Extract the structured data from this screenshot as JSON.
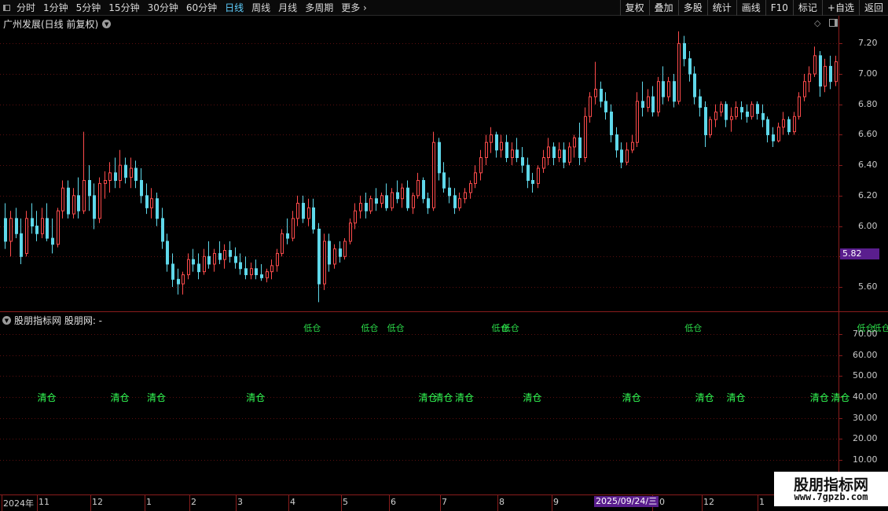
{
  "toolbar": {
    "periods": [
      {
        "label": "分时",
        "active": false
      },
      {
        "label": "1分钟",
        "active": false
      },
      {
        "label": "5分钟",
        "active": false
      },
      {
        "label": "15分钟",
        "active": false
      },
      {
        "label": "30分钟",
        "active": false
      },
      {
        "label": "60分钟",
        "active": false
      },
      {
        "label": "日线",
        "active": true
      },
      {
        "label": "周线",
        "active": false
      },
      {
        "label": "月线",
        "active": false
      },
      {
        "label": "多周期",
        "active": false
      }
    ],
    "more_label": "更多",
    "buttons": [
      "复权",
      "叠加",
      "多股",
      "统计",
      "画线",
      "F10",
      "标记",
      "+自选",
      "返回"
    ]
  },
  "main_panel": {
    "title": "广州发展(日线 前复权)",
    "price_ticks": [
      7.2,
      7.0,
      6.8,
      6.6,
      6.4,
      6.2,
      6.0,
      5.8,
      5.6
    ],
    "current_price_label": "5.82",
    "colors": {
      "up": "#ff4b4b",
      "down": "#5fd8ea",
      "current_price_bg": "#5a1e8e",
      "grid": "#5a0f0f"
    }
  },
  "indicator_panel": {
    "title": "股朋指标网  股朋网: -",
    "value_ticks": [
      "70.00",
      "60.00",
      "50.00",
      "40.00",
      "30.00",
      "20.00",
      "10.00"
    ],
    "signal_label": "清仓",
    "top_signal_label": "低仓",
    "signal_color": "#33ff55"
  },
  "date_axis": {
    "labels": [
      "2024年",
      "11",
      "12",
      "1",
      "2",
      "3",
      "4",
      "5",
      "6",
      "7",
      "8",
      "9",
      "10",
      "12",
      "1"
    ],
    "cursor_date": "2025/09/24/三"
  },
  "watermark": {
    "title": "股朋指标网",
    "url": "www.7gpzb.com"
  },
  "chart_data": {
    "type": "candlestick",
    "title": "广州发展(日线 前复权)",
    "ylim": [
      5.45,
      7.3
    ],
    "start_date": "2024-10-08",
    "candles": [
      {
        "o": 6.05,
        "h": 6.15,
        "l": 5.85,
        "c": 5.9
      },
      {
        "o": 5.9,
        "h": 6.1,
        "l": 5.8,
        "c": 6.05
      },
      {
        "o": 6.05,
        "h": 6.12,
        "l": 5.92,
        "c": 5.95
      },
      {
        "o": 5.95,
        "h": 6.05,
        "l": 5.75,
        "c": 5.8
      },
      {
        "o": 5.82,
        "h": 6.1,
        "l": 5.8,
        "c": 6.05
      },
      {
        "o": 6.05,
        "h": 6.15,
        "l": 5.95,
        "c": 6.0
      },
      {
        "o": 6.0,
        "h": 6.1,
        "l": 5.9,
        "c": 5.95
      },
      {
        "o": 5.95,
        "h": 6.12,
        "l": 5.92,
        "c": 6.05
      },
      {
        "o": 6.05,
        "h": 6.15,
        "l": 5.9,
        "c": 5.92
      },
      {
        "o": 5.92,
        "h": 6.05,
        "l": 5.82,
        "c": 5.88
      },
      {
        "o": 5.88,
        "h": 6.12,
        "l": 5.86,
        "c": 6.1
      },
      {
        "o": 6.1,
        "h": 6.3,
        "l": 6.05,
        "c": 6.25
      },
      {
        "o": 6.25,
        "h": 6.3,
        "l": 6.05,
        "c": 6.08
      },
      {
        "o": 6.08,
        "h": 6.25,
        "l": 6.05,
        "c": 6.2
      },
      {
        "o": 6.2,
        "h": 6.32,
        "l": 6.05,
        "c": 6.1
      },
      {
        "o": 6.1,
        "h": 6.62,
        "l": 6.08,
        "c": 6.3
      },
      {
        "o": 6.3,
        "h": 6.4,
        "l": 6.1,
        "c": 6.2
      },
      {
        "o": 6.2,
        "h": 6.28,
        "l": 5.98,
        "c": 6.05
      },
      {
        "o": 6.05,
        "h": 6.32,
        "l": 6.02,
        "c": 6.28
      },
      {
        "o": 6.28,
        "h": 6.36,
        "l": 6.18,
        "c": 6.3
      },
      {
        "o": 6.3,
        "h": 6.42,
        "l": 6.22,
        "c": 6.35
      },
      {
        "o": 6.35,
        "h": 6.45,
        "l": 6.25,
        "c": 6.3
      },
      {
        "o": 6.3,
        "h": 6.5,
        "l": 6.25,
        "c": 6.4
      },
      {
        "o": 6.4,
        "h": 6.45,
        "l": 6.28,
        "c": 6.32
      },
      {
        "o": 6.32,
        "h": 6.45,
        "l": 6.25,
        "c": 6.38
      },
      {
        "o": 6.38,
        "h": 6.43,
        "l": 6.25,
        "c": 6.3
      },
      {
        "o": 6.3,
        "h": 6.38,
        "l": 6.15,
        "c": 6.2
      },
      {
        "o": 6.2,
        "h": 6.28,
        "l": 6.08,
        "c": 6.12
      },
      {
        "o": 6.12,
        "h": 6.25,
        "l": 6.05,
        "c": 6.18
      },
      {
        "o": 6.18,
        "h": 6.22,
        "l": 6.0,
        "c": 6.05
      },
      {
        "o": 6.05,
        "h": 6.12,
        "l": 5.85,
        "c": 5.9
      },
      {
        "o": 5.9,
        "h": 5.95,
        "l": 5.7,
        "c": 5.75
      },
      {
        "o": 5.75,
        "h": 5.82,
        "l": 5.6,
        "c": 5.65
      },
      {
        "o": 5.65,
        "h": 5.72,
        "l": 5.55,
        "c": 5.62
      },
      {
        "o": 5.62,
        "h": 5.7,
        "l": 5.55,
        "c": 5.68
      },
      {
        "o": 5.68,
        "h": 5.82,
        "l": 5.65,
        "c": 5.78
      },
      {
        "o": 5.78,
        "h": 5.85,
        "l": 5.7,
        "c": 5.75
      },
      {
        "o": 5.75,
        "h": 5.82,
        "l": 5.65,
        "c": 5.7
      },
      {
        "o": 5.7,
        "h": 5.85,
        "l": 5.68,
        "c": 5.8
      },
      {
        "o": 5.8,
        "h": 5.9,
        "l": 5.72,
        "c": 5.75
      },
      {
        "o": 5.75,
        "h": 5.85,
        "l": 5.7,
        "c": 5.82
      },
      {
        "o": 5.82,
        "h": 5.9,
        "l": 5.75,
        "c": 5.78
      },
      {
        "o": 5.78,
        "h": 5.88,
        "l": 5.72,
        "c": 5.84
      },
      {
        "o": 5.84,
        "h": 5.9,
        "l": 5.76,
        "c": 5.8
      },
      {
        "o": 5.8,
        "h": 5.86,
        "l": 5.72,
        "c": 5.76
      },
      {
        "o": 5.76,
        "h": 5.82,
        "l": 5.68,
        "c": 5.72
      },
      {
        "o": 5.72,
        "h": 5.8,
        "l": 5.65,
        "c": 5.68
      },
      {
        "o": 5.68,
        "h": 5.76,
        "l": 5.65,
        "c": 5.72
      },
      {
        "o": 5.72,
        "h": 5.78,
        "l": 5.65,
        "c": 5.68
      },
      {
        "o": 5.68,
        "h": 5.75,
        "l": 5.64,
        "c": 5.66
      },
      {
        "o": 5.66,
        "h": 5.72,
        "l": 5.63,
        "c": 5.7
      },
      {
        "o": 5.7,
        "h": 5.78,
        "l": 5.65,
        "c": 5.74
      },
      {
        "o": 5.74,
        "h": 5.85,
        "l": 5.7,
        "c": 5.82
      },
      {
        "o": 5.82,
        "h": 5.98,
        "l": 5.8,
        "c": 5.95
      },
      {
        "o": 5.95,
        "h": 6.05,
        "l": 5.88,
        "c": 5.92
      },
      {
        "o": 5.92,
        "h": 6.1,
        "l": 5.9,
        "c": 6.05
      },
      {
        "o": 6.05,
        "h": 6.2,
        "l": 6.0,
        "c": 6.15
      },
      {
        "o": 6.15,
        "h": 6.2,
        "l": 6.02,
        "c": 6.05
      },
      {
        "o": 6.05,
        "h": 6.18,
        "l": 6.0,
        "c": 6.12
      },
      {
        "o": 6.12,
        "h": 6.18,
        "l": 5.95,
        "c": 5.98
      },
      {
        "o": 5.98,
        "h": 6.02,
        "l": 5.5,
        "c": 5.62
      },
      {
        "o": 5.62,
        "h": 5.95,
        "l": 5.58,
        "c": 5.9
      },
      {
        "o": 5.9,
        "h": 5.95,
        "l": 5.7,
        "c": 5.75
      },
      {
        "o": 5.75,
        "h": 5.88,
        "l": 5.72,
        "c": 5.85
      },
      {
        "o": 5.85,
        "h": 5.9,
        "l": 5.76,
        "c": 5.8
      },
      {
        "o": 5.8,
        "h": 5.92,
        "l": 5.78,
        "c": 5.9
      },
      {
        "o": 5.9,
        "h": 6.05,
        "l": 5.88,
        "c": 6.02
      },
      {
        "o": 6.02,
        "h": 6.15,
        "l": 5.98,
        "c": 6.1
      },
      {
        "o": 6.1,
        "h": 6.2,
        "l": 6.05,
        "c": 6.15
      },
      {
        "o": 6.15,
        "h": 6.22,
        "l": 6.05,
        "c": 6.1
      },
      {
        "o": 6.1,
        "h": 6.2,
        "l": 6.08,
        "c": 6.18
      },
      {
        "o": 6.18,
        "h": 6.25,
        "l": 6.1,
        "c": 6.15
      },
      {
        "o": 6.15,
        "h": 6.22,
        "l": 6.12,
        "c": 6.2
      },
      {
        "o": 6.2,
        "h": 6.28,
        "l": 6.1,
        "c": 6.12
      },
      {
        "o": 6.12,
        "h": 6.25,
        "l": 6.1,
        "c": 6.22
      },
      {
        "o": 6.22,
        "h": 6.3,
        "l": 6.15,
        "c": 6.18
      },
      {
        "o": 6.18,
        "h": 6.28,
        "l": 6.12,
        "c": 6.25
      },
      {
        "o": 6.25,
        "h": 6.3,
        "l": 6.1,
        "c": 6.12
      },
      {
        "o": 6.12,
        "h": 6.22,
        "l": 6.08,
        "c": 6.2
      },
      {
        "o": 6.2,
        "h": 6.35,
        "l": 6.18,
        "c": 6.3
      },
      {
        "o": 6.3,
        "h": 6.32,
        "l": 6.15,
        "c": 6.18
      },
      {
        "o": 6.18,
        "h": 6.22,
        "l": 6.08,
        "c": 6.12
      },
      {
        "o": 6.12,
        "h": 6.62,
        "l": 6.1,
        "c": 6.55
      },
      {
        "o": 6.55,
        "h": 6.58,
        "l": 6.3,
        "c": 6.35
      },
      {
        "o": 6.35,
        "h": 6.42,
        "l": 6.22,
        "c": 6.25
      },
      {
        "o": 6.25,
        "h": 6.32,
        "l": 6.15,
        "c": 6.2
      },
      {
        "o": 6.2,
        "h": 6.25,
        "l": 6.08,
        "c": 6.12
      },
      {
        "o": 6.12,
        "h": 6.22,
        "l": 6.1,
        "c": 6.18
      },
      {
        "o": 6.18,
        "h": 6.25,
        "l": 6.15,
        "c": 6.22
      },
      {
        "o": 6.22,
        "h": 6.3,
        "l": 6.18,
        "c": 6.28
      },
      {
        "o": 6.28,
        "h": 6.4,
        "l": 6.25,
        "c": 6.35
      },
      {
        "o": 6.35,
        "h": 6.5,
        "l": 6.3,
        "c": 6.45
      },
      {
        "o": 6.45,
        "h": 6.6,
        "l": 6.4,
        "c": 6.55
      },
      {
        "o": 6.55,
        "h": 6.65,
        "l": 6.48,
        "c": 6.6
      },
      {
        "o": 6.6,
        "h": 6.62,
        "l": 6.45,
        "c": 6.5
      },
      {
        "o": 6.5,
        "h": 6.6,
        "l": 6.45,
        "c": 6.55
      },
      {
        "o": 6.55,
        "h": 6.6,
        "l": 6.42,
        "c": 6.45
      },
      {
        "o": 6.45,
        "h": 6.55,
        "l": 6.4,
        "c": 6.5
      },
      {
        "o": 6.5,
        "h": 6.58,
        "l": 6.42,
        "c": 6.45
      },
      {
        "o": 6.45,
        "h": 6.52,
        "l": 6.35,
        "c": 6.4
      },
      {
        "o": 6.4,
        "h": 6.45,
        "l": 6.25,
        "c": 6.3
      },
      {
        "o": 6.3,
        "h": 6.35,
        "l": 6.22,
        "c": 6.28
      },
      {
        "o": 6.28,
        "h": 6.4,
        "l": 6.25,
        "c": 6.38
      },
      {
        "o": 6.38,
        "h": 6.5,
        "l": 6.35,
        "c": 6.45
      },
      {
        "o": 6.45,
        "h": 6.58,
        "l": 6.4,
        "c": 6.52
      },
      {
        "o": 6.52,
        "h": 6.55,
        "l": 6.4,
        "c": 6.45
      },
      {
        "o": 6.45,
        "h": 6.55,
        "l": 6.42,
        "c": 6.5
      },
      {
        "o": 6.5,
        "h": 6.55,
        "l": 6.38,
        "c": 6.42
      },
      {
        "o": 6.42,
        "h": 6.55,
        "l": 6.4,
        "c": 6.52
      },
      {
        "o": 6.52,
        "h": 6.6,
        "l": 6.45,
        "c": 6.58
      },
      {
        "o": 6.58,
        "h": 6.68,
        "l": 6.4,
        "c": 6.45
      },
      {
        "o": 6.45,
        "h": 6.78,
        "l": 6.42,
        "c": 6.72
      },
      {
        "o": 6.72,
        "h": 6.88,
        "l": 6.68,
        "c": 6.85
      },
      {
        "o": 6.85,
        "h": 7.08,
        "l": 6.8,
        "c": 6.9
      },
      {
        "o": 6.9,
        "h": 6.95,
        "l": 6.78,
        "c": 6.82
      },
      {
        "o": 6.82,
        "h": 6.88,
        "l": 6.7,
        "c": 6.75
      },
      {
        "o": 6.75,
        "h": 6.8,
        "l": 6.55,
        "c": 6.6
      },
      {
        "o": 6.6,
        "h": 6.65,
        "l": 6.45,
        "c": 6.5
      },
      {
        "o": 6.5,
        "h": 6.55,
        "l": 6.38,
        "c": 6.42
      },
      {
        "o": 6.42,
        "h": 6.55,
        "l": 6.4,
        "c": 6.5
      },
      {
        "o": 6.5,
        "h": 6.6,
        "l": 6.48,
        "c": 6.55
      },
      {
        "o": 6.55,
        "h": 6.88,
        "l": 6.52,
        "c": 6.82
      },
      {
        "o": 6.82,
        "h": 6.95,
        "l": 6.72,
        "c": 6.78
      },
      {
        "o": 6.78,
        "h": 6.9,
        "l": 6.75,
        "c": 6.85
      },
      {
        "o": 6.85,
        "h": 6.92,
        "l": 6.72,
        "c": 6.75
      },
      {
        "o": 6.75,
        "h": 6.98,
        "l": 6.72,
        "c": 6.95
      },
      {
        "o": 6.95,
        "h": 7.05,
        "l": 6.8,
        "c": 6.85
      },
      {
        "o": 6.85,
        "h": 6.98,
        "l": 6.82,
        "c": 6.95
      },
      {
        "o": 6.95,
        "h": 7.0,
        "l": 6.78,
        "c": 6.82
      },
      {
        "o": 6.82,
        "h": 7.28,
        "l": 6.8,
        "c": 7.2
      },
      {
        "o": 7.2,
        "h": 7.25,
        "l": 7.05,
        "c": 7.1
      },
      {
        "o": 7.1,
        "h": 7.15,
        "l": 6.95,
        "c": 7.0
      },
      {
        "o": 7.0,
        "h": 7.05,
        "l": 6.8,
        "c": 6.85
      },
      {
        "o": 6.85,
        "h": 6.9,
        "l": 6.72,
        "c": 6.78
      },
      {
        "o": 6.78,
        "h": 6.82,
        "l": 6.52,
        "c": 6.6
      },
      {
        "o": 6.6,
        "h": 6.72,
        "l": 6.58,
        "c": 6.7
      },
      {
        "o": 6.7,
        "h": 6.8,
        "l": 6.65,
        "c": 6.75
      },
      {
        "o": 6.75,
        "h": 6.82,
        "l": 6.72,
        "c": 6.8
      },
      {
        "o": 6.8,
        "h": 6.82,
        "l": 6.65,
        "c": 6.7
      },
      {
        "o": 6.7,
        "h": 6.78,
        "l": 6.62,
        "c": 6.72
      },
      {
        "o": 6.72,
        "h": 6.82,
        "l": 6.7,
        "c": 6.78
      },
      {
        "o": 6.78,
        "h": 6.82,
        "l": 6.7,
        "c": 6.75
      },
      {
        "o": 6.75,
        "h": 6.8,
        "l": 6.68,
        "c": 6.72
      },
      {
        "o": 6.72,
        "h": 6.82,
        "l": 6.7,
        "c": 6.8
      },
      {
        "o": 6.8,
        "h": 6.82,
        "l": 6.7,
        "c": 6.74
      },
      {
        "o": 6.74,
        "h": 6.8,
        "l": 6.65,
        "c": 6.7
      },
      {
        "o": 6.7,
        "h": 6.72,
        "l": 6.55,
        "c": 6.6
      },
      {
        "o": 6.6,
        "h": 6.65,
        "l": 6.52,
        "c": 6.56
      },
      {
        "o": 6.56,
        "h": 6.68,
        "l": 6.55,
        "c": 6.65
      },
      {
        "o": 6.65,
        "h": 6.75,
        "l": 6.6,
        "c": 6.7
      },
      {
        "o": 6.7,
        "h": 6.72,
        "l": 6.6,
        "c": 6.62
      },
      {
        "o": 6.62,
        "h": 6.75,
        "l": 6.6,
        "c": 6.72
      },
      {
        "o": 6.72,
        "h": 6.88,
        "l": 6.7,
        "c": 6.85
      },
      {
        "o": 6.85,
        "h": 7.0,
        "l": 6.82,
        "c": 6.95
      },
      {
        "o": 6.95,
        "h": 7.05,
        "l": 6.88,
        "c": 7.0
      },
      {
        "o": 7.0,
        "h": 7.18,
        "l": 6.98,
        "c": 7.12
      },
      {
        "o": 7.12,
        "h": 7.15,
        "l": 6.85,
        "c": 6.92
      },
      {
        "o": 6.92,
        "h": 7.1,
        "l": 6.88,
        "c": 7.05
      },
      {
        "o": 7.05,
        "h": 7.12,
        "l": 6.9,
        "c": 6.95
      },
      {
        "o": 6.95,
        "h": 7.12,
        "l": 6.92,
        "c": 7.08
      }
    ],
    "indicator_signals": [
      {
        "x": 8,
        "y": 40,
        "label": "清仓"
      },
      {
        "x": 22,
        "y": 40,
        "label": "清仓"
      },
      {
        "x": 29,
        "y": 40,
        "label": "清仓"
      },
      {
        "x": 48,
        "y": 40,
        "label": "清仓"
      },
      {
        "x": 81,
        "y": 40,
        "label": "清仓"
      },
      {
        "x": 84,
        "y": 40,
        "label": "清仓"
      },
      {
        "x": 88,
        "y": 40,
        "label": "清仓"
      },
      {
        "x": 101,
        "y": 40,
        "label": "清仓"
      },
      {
        "x": 120,
        "y": 40,
        "label": "清仓"
      },
      {
        "x": 134,
        "y": 40,
        "label": "清仓"
      },
      {
        "x": 140,
        "y": 40,
        "label": "清仓"
      },
      {
        "x": 156,
        "y": 40,
        "label": "清仓"
      },
      {
        "x": 160,
        "y": 40,
        "label": "清仓"
      }
    ],
    "indicator_top_signals": [
      {
        "x": 59,
        "y": 71,
        "label": "低仓"
      },
      {
        "x": 70,
        "y": 71,
        "label": "低仓"
      },
      {
        "x": 75,
        "y": 71,
        "label": "低仓"
      },
      {
        "x": 95,
        "y": 71,
        "label": "低仓"
      },
      {
        "x": 97,
        "y": 71,
        "label": "低仓"
      },
      {
        "x": 132,
        "y": 71,
        "label": "低仓"
      },
      {
        "x": 165,
        "y": 71,
        "label": "低仓"
      },
      {
        "x": 168,
        "y": 71,
        "label": "低仓"
      }
    ],
    "indicator_ylim": [
      5,
      75
    ]
  }
}
